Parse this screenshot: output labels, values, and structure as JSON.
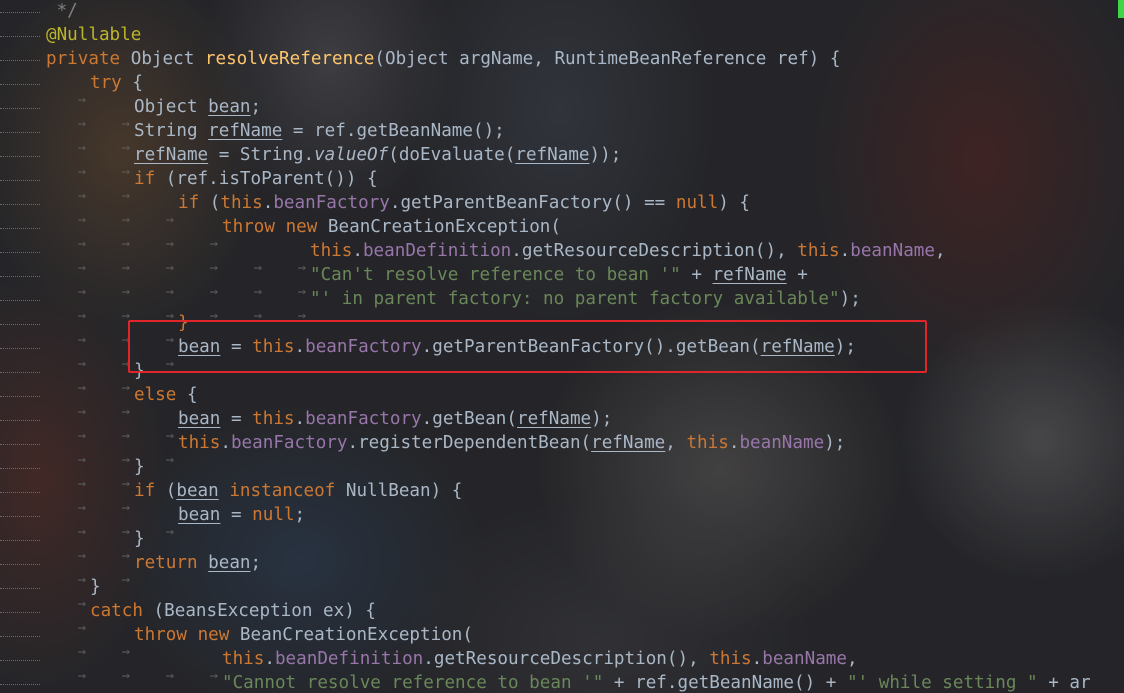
{
  "editor": {
    "language": "java",
    "highlight_color": "#e0262a",
    "marker_color": "#3fd64a",
    "code": {
      "l0": {
        "cmt": " */"
      },
      "l1": {
        "ann": "@Nullable"
      },
      "l2": {
        "kw1": "private",
        "t1": " Object ",
        "fn": "resolveReference",
        "t2": "(Object argName, RuntimeBeanReference ref) {"
      },
      "l3": {
        "kw1": "try",
        "t1": " {"
      },
      "l4": {
        "t1": "Object ",
        "v1": "bean",
        "t2": ";"
      },
      "l5": {
        "t1": "String ",
        "v1": "refName",
        "t2": " = ref.getBeanName();"
      },
      "l6": {
        "v1": "refName",
        "t1": " = String.",
        "it": "valueOf",
        "t2": "(doEvaluate(",
        "v2": "refName",
        "t3": "));"
      },
      "l7": {
        "kw1": "if",
        "t1": " (ref.isToParent()) {"
      },
      "l8": {
        "kw1": "if",
        "t1": " (",
        "kw2": "this",
        "t2": ".",
        "f1": "beanFactory",
        "t3": ".getParentBeanFactory() == ",
        "kw3": "null",
        "t4": ") {"
      },
      "l9": {
        "kw1": "throw",
        "t1": " ",
        "kw2": "new",
        "t2": " BeanCreationException("
      },
      "l10": {
        "kw1": "this",
        "t1": ".",
        "f1": "beanDefinition",
        "t2": ".getResourceDescription(), ",
        "kw2": "this",
        "t3": ".",
        "f2": "beanName",
        "t4": ","
      },
      "l11": {
        "s1": "\"Can't resolve reference to bean '\"",
        "t1": " + ",
        "v1": "refName",
        "t2": " +"
      },
      "l12": {
        "s1": "\"' in parent factory: no parent factory available\"",
        "t1": ");"
      },
      "l13": {
        "t1": "}"
      },
      "l14": {
        "v1": "bean",
        "t1": " = ",
        "kw1": "this",
        "t2": ".",
        "f1": "beanFactory",
        "t3": ".getParentBeanFactory().getBean(",
        "v2": "refName",
        "t4": ");"
      },
      "l15": {
        "t1": "}"
      },
      "l16": {
        "kw1": "else",
        "t1": " {"
      },
      "l17": {
        "v1": "bean",
        "t1": " = ",
        "kw1": "this",
        "t2": ".",
        "f1": "beanFactory",
        "t3": ".getBean(",
        "v2": "refName",
        "t4": ");"
      },
      "l18": {
        "kw1": "this",
        "t1": ".",
        "f1": "beanFactory",
        "t2": ".registerDependentBean(",
        "v1": "refName",
        "t3": ", ",
        "kw2": "this",
        "t4": ".",
        "f2": "beanName",
        "t5": ");"
      },
      "l19": {
        "t1": "}"
      },
      "l20": {
        "kw1": "if",
        "t1": " (",
        "v1": "bean",
        "t2": " ",
        "kw2": "instanceof",
        "t3": " NullBean) {"
      },
      "l21": {
        "v1": "bean",
        "t1": " = ",
        "kw1": "null",
        "t2": ";"
      },
      "l22": {
        "t1": "}"
      },
      "l23": {
        "kw1": "return",
        "t1": " ",
        "v1": "bean",
        "t2": ";"
      },
      "l24": {
        "t1": "}"
      },
      "l25": {
        "kw1": "catch",
        "t1": " (BeansException ex) {"
      },
      "l26": {
        "kw1": "throw",
        "t1": " ",
        "kw2": "new",
        "t2": " BeanCreationException("
      },
      "l27": {
        "kw1": "this",
        "t1": ".",
        "f1": "beanDefinition",
        "t2": ".getResourceDescription(), ",
        "kw2": "this",
        "t3": ".",
        "f2": "beanName",
        "t4": ","
      },
      "l28": {
        "s1": "\"Cannot resolve reference to bean '\"",
        "t1": " + ref.getBeanName() + ",
        "s2": "\"' while setting \"",
        "t2": " + ar"
      }
    }
  }
}
